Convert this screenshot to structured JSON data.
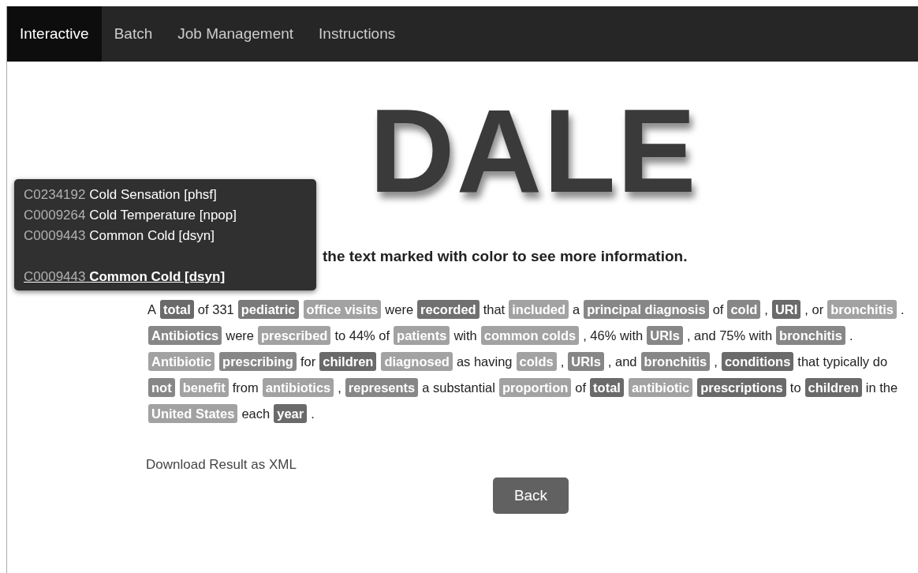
{
  "nav": {
    "tabs": [
      {
        "label": "Interactive",
        "selected": true
      },
      {
        "label": "Batch",
        "selected": false
      },
      {
        "label": "Job Management",
        "selected": false
      },
      {
        "label": "Instructions",
        "selected": false
      }
    ]
  },
  "logo": "DALE",
  "tooltip": {
    "items": [
      {
        "id": "C0234192",
        "name": "Cold Sensation [phsf]"
      },
      {
        "id": "C0009264",
        "name": "Cold Temperature [npop]"
      },
      {
        "id": "C0009443",
        "name": "Common Cold [dsyn]"
      }
    ],
    "selected": {
      "id": "C0009443",
      "name": "Common Cold [dsyn]"
    }
  },
  "instruction": "the text marked with color to see more information.",
  "paragraph": [
    {
      "text": "A"
    },
    {
      "text": "total",
      "color": "#6a6a6a"
    },
    {
      "text": "of 331"
    },
    {
      "text": "pediatric",
      "color": "#7a7a7a"
    },
    {
      "text": "office visits",
      "color": "#a2a2a2"
    },
    {
      "text": "were"
    },
    {
      "text": "recorded",
      "color": "#707070"
    },
    {
      "text": "that"
    },
    {
      "text": "included",
      "color": "#a2a2a2"
    },
    {
      "text": "a"
    },
    {
      "text": "principal diagnosis",
      "color": "#878787"
    },
    {
      "text": "of"
    },
    {
      "text": "cold",
      "color": "#878787"
    },
    {
      "text": ","
    },
    {
      "text": "URI",
      "color": "#6a6a6a"
    },
    {
      "text": ", or"
    },
    {
      "text": "bronchitis",
      "color": "#a2a2a2"
    },
    {
      "text": "."
    },
    {
      "text": "Antibiotics",
      "color": "#878787"
    },
    {
      "text": "were"
    },
    {
      "text": "prescribed",
      "color": "#a2a2a2"
    },
    {
      "text": "to 44% of"
    },
    {
      "text": "patients",
      "color": "#a2a2a2"
    },
    {
      "text": "with"
    },
    {
      "text": "common colds",
      "color": "#a2a2a2"
    },
    {
      "text": ", 46% with"
    },
    {
      "text": "URIs",
      "color": "#878787"
    },
    {
      "text": ", and 75% with"
    },
    {
      "text": "bronchitis",
      "color": "#878787"
    },
    {
      "text": "."
    },
    {
      "text": "Antibiotic",
      "color": "#a2a2a2"
    },
    {
      "text": "prescribing",
      "color": "#878787"
    },
    {
      "text": "for"
    },
    {
      "text": "children",
      "color": "#6a6a6a"
    },
    {
      "text": "diagnosed",
      "color": "#a2a2a2"
    },
    {
      "text": "as having"
    },
    {
      "text": "colds",
      "color": "#a2a2a2"
    },
    {
      "text": ","
    },
    {
      "text": "URIs",
      "color": "#878787"
    },
    {
      "text": ", and"
    },
    {
      "text": "bronchitis",
      "color": "#878787"
    },
    {
      "text": ","
    },
    {
      "text": "conditions",
      "color": "#6a6a6a"
    },
    {
      "text": "that typically do"
    },
    {
      "text": "not",
      "color": "#878787"
    },
    {
      "text": "benefit",
      "color": "#a2a2a2"
    },
    {
      "text": "from"
    },
    {
      "text": "antibiotics",
      "color": "#a2a2a2"
    },
    {
      "text": ","
    },
    {
      "text": "represents",
      "color": "#878787"
    },
    {
      "text": "a substantial"
    },
    {
      "text": "proportion",
      "color": "#a2a2a2"
    },
    {
      "text": "of"
    },
    {
      "text": "total",
      "color": "#6a6a6a"
    },
    {
      "text": "antibiotic",
      "color": "#a2a2a2"
    },
    {
      "text": "prescriptions",
      "color": "#6a6a6a"
    },
    {
      "text": "to"
    },
    {
      "text": "children",
      "color": "#6a6a6a"
    },
    {
      "text": "in the"
    },
    {
      "text": "United States",
      "color": "#a2a2a2"
    },
    {
      "text": "each"
    },
    {
      "text": "year",
      "color": "#6a6a6a"
    },
    {
      "text": "."
    }
  ],
  "download_link": "Download Result as XML",
  "back_button": "Back"
}
